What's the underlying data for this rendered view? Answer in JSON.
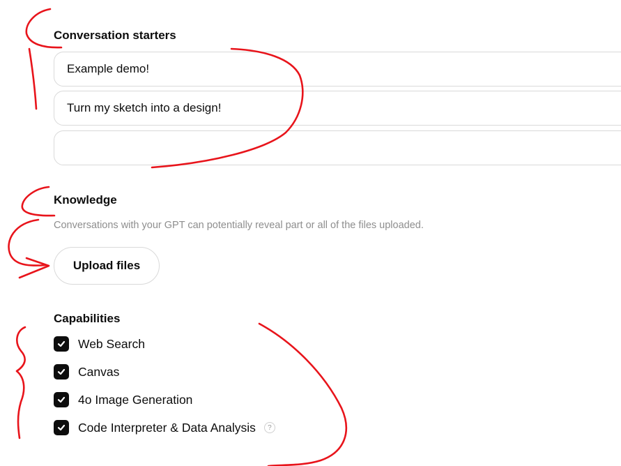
{
  "conversation_starters": {
    "title": "Conversation starters",
    "items": [
      {
        "value": "Example demo!"
      },
      {
        "value": "Turn my sketch into a design!"
      },
      {
        "value": ""
      }
    ]
  },
  "knowledge": {
    "title": "Knowledge",
    "hint": "Conversations with your GPT can potentially reveal part or all of the files uploaded.",
    "upload_label": "Upload files"
  },
  "capabilities": {
    "title": "Capabilities",
    "items": [
      {
        "label": "Web Search",
        "checked": true
      },
      {
        "label": "Canvas",
        "checked": true
      },
      {
        "label": "4o Image Generation",
        "checked": true
      },
      {
        "label": "Code Interpreter & Data Analysis",
        "checked": true,
        "help": "?"
      }
    ]
  },
  "colors": {
    "annotation": "#e8141b",
    "checkbox": "#0d0d0d",
    "border": "#d9d9d9",
    "hint_text": "#8e8e8e"
  }
}
